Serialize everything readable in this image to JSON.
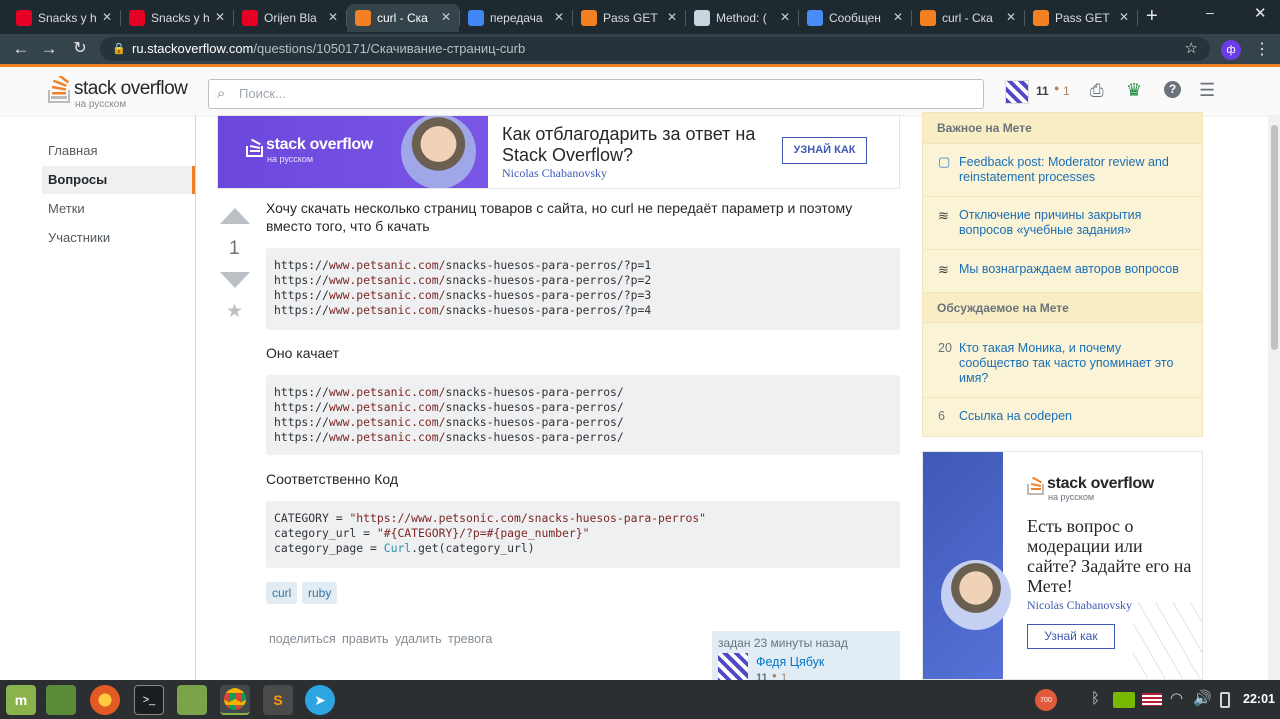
{
  "browser": {
    "tabs": [
      {
        "title": "Snacks y h",
        "icon": "pinterest-icon",
        "color": "#e60023"
      },
      {
        "title": "Snacks y h",
        "icon": "pinterest-icon",
        "color": "#e60023"
      },
      {
        "title": "Orijen Bla",
        "icon": "pinterest-icon",
        "color": "#e60023"
      },
      {
        "title": "curl - Ска",
        "icon": "stackoverflow-icon",
        "color": "#f48024"
      },
      {
        "title": "передача",
        "icon": "google-icon",
        "color": "#4285f4"
      },
      {
        "title": "Pass GET",
        "icon": "stackoverflow-icon",
        "color": "#f48024"
      },
      {
        "title": "Method: (",
        "icon": "ruby-doc-icon",
        "color": "#c7d5de"
      },
      {
        "title": "Сообщен",
        "icon": "chat-icon",
        "color": "#4a8cf7"
      },
      {
        "title": "curl - Ска",
        "icon": "stackoverflow-icon",
        "color": "#f48024"
      },
      {
        "title": "Pass GET",
        "icon": "stackoverflow-icon",
        "color": "#f48024"
      }
    ],
    "url_host": "ru.stackoverflow.com",
    "url_path": "/questions/1050171/Скачивание-страниц-curb",
    "profile_letter": "ф"
  },
  "topbar": {
    "logo_main": "stack overflow",
    "logo_sub": "на русском",
    "search_placeholder": "Поиск...",
    "rep": "11",
    "badge_count": "1"
  },
  "left_nav": [
    "Главная",
    "Вопросы",
    "Метки",
    "Участники"
  ],
  "banner": {
    "logo_main": "stack overflow",
    "logo_sub": "на русском",
    "headline": "Как отблагодарить за ответ на Stack Overflow?",
    "author": "Nicolas Chabanovsky",
    "button": "УЗНАЙ КАК"
  },
  "question": {
    "votes": "1",
    "intro": "Хочу скачать несколько страниц товаров с сайта, но curl не передаёт параметр и поэтому вместо того, что б качать",
    "code1": [
      [
        "https://",
        "www.petsanic.com/",
        "snacks-huesos-para-perros/?p=1"
      ],
      [
        "https://",
        "www.petsanic.com/",
        "snacks-huesos-para-perros/?p=2"
      ],
      [
        "https://",
        "www.petsanic.com/",
        "snacks-huesos-para-perros/?p=3"
      ],
      [
        "https://",
        "www.petsanic.com/",
        "snacks-huesos-para-perros/?p=4"
      ]
    ],
    "mid": "Оно качает",
    "code2": [
      [
        "https://",
        "www.petsanic.com/",
        "snacks-huesos-para-perros/"
      ],
      [
        "https://",
        "www.petsanic.com/",
        "snacks-huesos-para-perros/"
      ],
      [
        "https://",
        "www.petsanic.com/",
        "snacks-huesos-para-perros/"
      ],
      [
        "https://",
        "www.petsanic.com/",
        "snacks-huesos-para-perros/"
      ]
    ],
    "code_heading": "Соответственно Код",
    "code3": {
      "l1_a": "CATEGORY = ",
      "l1_s": "\"https://www.petsonic.com/snacks-huesos-para-perros\"",
      "l2_a": "category_url = ",
      "l2_s": "\"#{CATEGORY}/?p=#{page_number}\"",
      "l3_a": "category_page = ",
      "l3_k": "Curl",
      "l3_b": ".get(category_url)"
    },
    "tags": [
      "curl",
      "ruby"
    ],
    "actions": [
      "поделиться",
      "править",
      "удалить",
      "тревога"
    ],
    "asked": "задан 23 минуты назад",
    "user_name": "Федя Цябук",
    "user_rep": "11",
    "user_badges": "1"
  },
  "sidebar": {
    "meta_head": "Важное на Мете",
    "meta_items": [
      {
        "icon": "chat-bubble-icon",
        "text": "Feedback post: Moderator review and reinstatement processes"
      },
      {
        "icon": "stackexchange-icon",
        "text": "Отключение причины закрытия вопросов «учебные задания»"
      },
      {
        "icon": "stackexchange-icon",
        "text": "Мы вознаграждаем авторов вопросов"
      }
    ],
    "hot_head": "Обсуждаемое на Мете",
    "hot_items": [
      {
        "count": "20",
        "text": "Кто такая Моника, и почему сообщество так часто упоминает это имя?"
      },
      {
        "count": "6",
        "text": "Ссылка на codepen"
      }
    ],
    "ad": {
      "logo_main": "stack overflow",
      "logo_sub": "на русском",
      "text": "Есть вопрос о модерации или сайте? Задайте его на Мете!",
      "author": "Nicolas Chabanovsky",
      "button": "Узнай как"
    }
  },
  "taskbar": {
    "time": "22:01",
    "notif_count": "700"
  },
  "colors": {
    "accent": "#f48024",
    "link": "#0077cc",
    "banner_purple": "#6b47dc"
  }
}
